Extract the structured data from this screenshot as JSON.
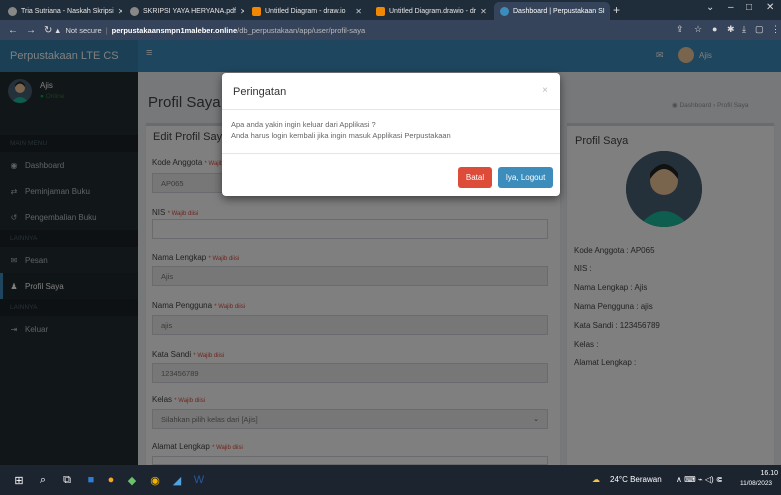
{
  "browser": {
    "tabs": [
      {
        "label": "Tria Sutriana - Naskah Skripsi",
        "icon": "globe-icon"
      },
      {
        "label": "SKRIPSI YAYA HERYANA.pdf",
        "icon": "globe-icon"
      },
      {
        "label": "Untitled Diagram - draw.io",
        "icon": "drawio-icon"
      },
      {
        "label": "Untitled Diagram.drawio - dr",
        "icon": "drawio-icon"
      },
      {
        "label": "Dashboard | Perpustakaan SI",
        "icon": "app-icon"
      }
    ],
    "security_label": "Not secure",
    "url_host": "perpustakaansmpn1maleber.online",
    "url_path": "/db_perpustakaan/app/user/profil-saya"
  },
  "app": {
    "brand": "Perpustakaan LTE CS",
    "user_name": "Ajis",
    "user_status": "Online",
    "menu_headers": [
      "MAIN MENU",
      "LAINNYA",
      "LAINNYA"
    ],
    "menu": [
      {
        "label": "Dashboard",
        "icon": "dashboard-icon"
      },
      {
        "label": "Peminjaman Buku",
        "icon": "exchange-icon"
      },
      {
        "label": "Pengembalian Buku",
        "icon": "return-icon"
      },
      {
        "label": "Pesan",
        "icon": "mail-icon"
      },
      {
        "label": "Profil Saya",
        "icon": "user-icon"
      },
      {
        "label": "Keluar",
        "icon": "logout-icon"
      }
    ],
    "active_menu": "Profil Saya",
    "top_user": "Ajis"
  },
  "page": {
    "title": "Profil Saya",
    "breadcrumb_home": "Dashboard",
    "breadcrumb_current": "Profil Saya",
    "form_title": "Edit Profil Saya",
    "required_tag": "* Wajib diisi",
    "fields": [
      {
        "label": "Kode Anggota",
        "value": "AP065"
      },
      {
        "label": "NIS",
        "value": ""
      },
      {
        "label": "Nama Lengkap",
        "value": "Ajis"
      },
      {
        "label": "Nama Pengguna",
        "value": "ajis"
      },
      {
        "label": "Kata Sandi",
        "value": "123456789"
      },
      {
        "label": "Kelas",
        "value": "Silahkan pilih kelas dari [Ajis]"
      },
      {
        "label": "Alamat Lengkap",
        "value": ""
      }
    ],
    "profile_title": "Profil Saya",
    "profile_lines": [
      "Kode Anggota : AP065",
      "NIS :",
      "Nama Lengkap : Ajis",
      "Nama Pengguna : ajis",
      "Kata Sandi : 123456789",
      "Kelas :",
      "Alamat Lengkap :"
    ]
  },
  "modal": {
    "title": "Peringatan",
    "line1": "Apa anda yakin ingin keluar dari Applikasi ?",
    "line2": "Anda harus login kembali jika ingin masuk Applikasi Perpustakaan",
    "cancel_label": "Batal",
    "confirm_label": "Iya, Logout",
    "cancel_color": "#dd4b39",
    "confirm_color": "#3c8dbc"
  },
  "taskbar": {
    "weather": "24°C  Berawan",
    "time": "16.10",
    "date": "11/08/2023"
  }
}
